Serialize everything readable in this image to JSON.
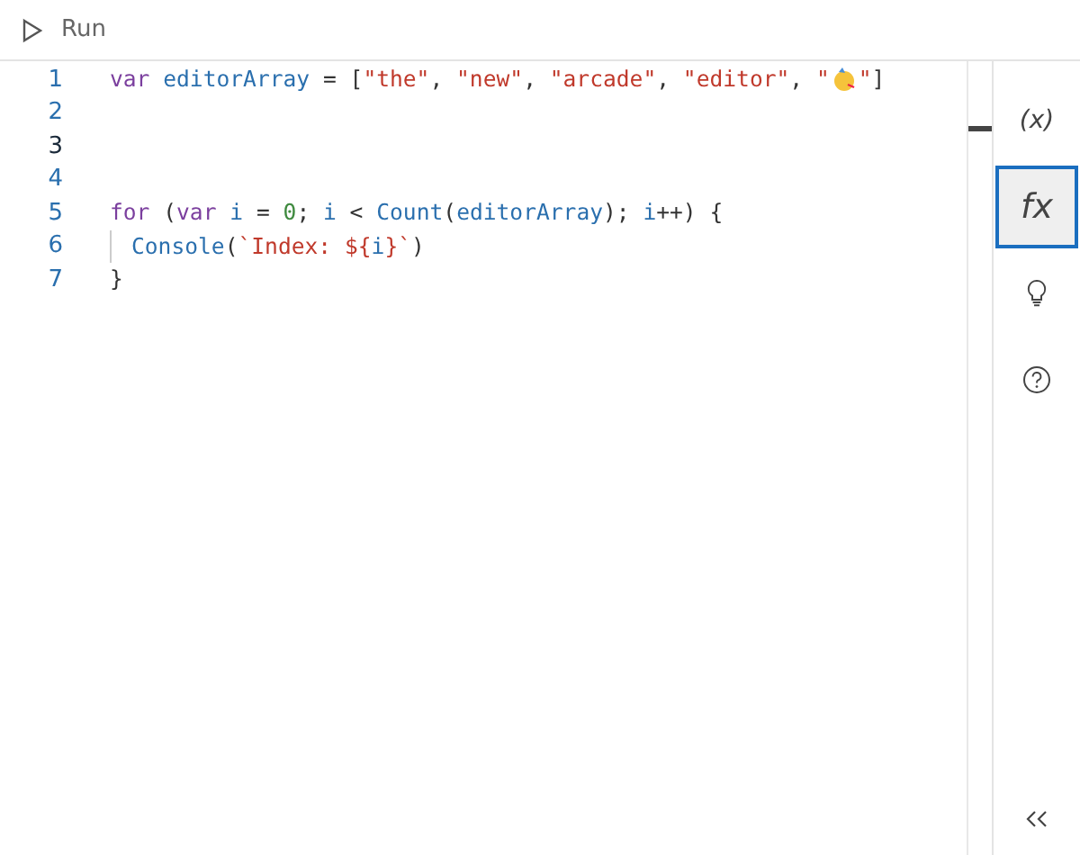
{
  "toolbar": {
    "run_label": "Run"
  },
  "lines": [
    {
      "number": "1",
      "current": false,
      "tokens": [
        {
          "kind": "keyword",
          "text": "var"
        },
        {
          "kind": "ident",
          "text": " editorArray"
        },
        {
          "kind": "plain",
          "text": " = ["
        },
        {
          "kind": "string",
          "text": "\"the\""
        },
        {
          "kind": "plain",
          "text": ", "
        },
        {
          "kind": "string",
          "text": "\"new\""
        },
        {
          "kind": "plain",
          "text": ", "
        },
        {
          "kind": "string",
          "text": "\"arcade\""
        },
        {
          "kind": "plain",
          "text": ", "
        },
        {
          "kind": "string",
          "text": "\"editor\""
        },
        {
          "kind": "plain",
          "text": ", "
        },
        {
          "kind": "string",
          "text": "\""
        },
        {
          "kind": "emoji"
        },
        {
          "kind": "string",
          "text": "\""
        },
        {
          "kind": "plain",
          "text": "]"
        }
      ]
    },
    {
      "number": "2",
      "current": false
    },
    {
      "number": "3",
      "current": true
    },
    {
      "number": "4",
      "current": false
    },
    {
      "number": "5",
      "current": false,
      "tokens": [
        {
          "kind": "keyword",
          "text": "for"
        },
        {
          "kind": "plain",
          "text": " ("
        },
        {
          "kind": "keyword",
          "text": "var"
        },
        {
          "kind": "ident",
          "text": " i"
        },
        {
          "kind": "plain",
          "text": " = "
        },
        {
          "kind": "number",
          "text": "0"
        },
        {
          "kind": "plain",
          "text": "; "
        },
        {
          "kind": "ident",
          "text": "i"
        },
        {
          "kind": "plain",
          "text": " < "
        },
        {
          "kind": "ident",
          "text": "Count"
        },
        {
          "kind": "plain",
          "text": "("
        },
        {
          "kind": "ident",
          "text": "editorArray"
        },
        {
          "kind": "plain",
          "text": "); "
        },
        {
          "kind": "ident",
          "text": "i"
        },
        {
          "kind": "plain",
          "text": "++) {"
        }
      ]
    },
    {
      "number": "6",
      "current": false,
      "indent": true,
      "tokens": [
        {
          "kind": "ident",
          "text": "Console"
        },
        {
          "kind": "plain",
          "text": "("
        },
        {
          "kind": "string",
          "text": "`Index: ${"
        },
        {
          "kind": "ident",
          "text": "i"
        },
        {
          "kind": "string",
          "text": "}`"
        },
        {
          "kind": "plain",
          "text": ")"
        }
      ]
    },
    {
      "number": "7",
      "current": false,
      "tokens": [
        {
          "kind": "plain",
          "text": "}"
        }
      ]
    }
  ],
  "side_tools": [
    {
      "kind": "text",
      "label": "(x)",
      "selected": false
    },
    {
      "kind": "text",
      "label": "fx",
      "selected": true
    },
    {
      "kind": "bulb",
      "selected": false
    },
    {
      "kind": "help",
      "selected": false
    }
  ]
}
